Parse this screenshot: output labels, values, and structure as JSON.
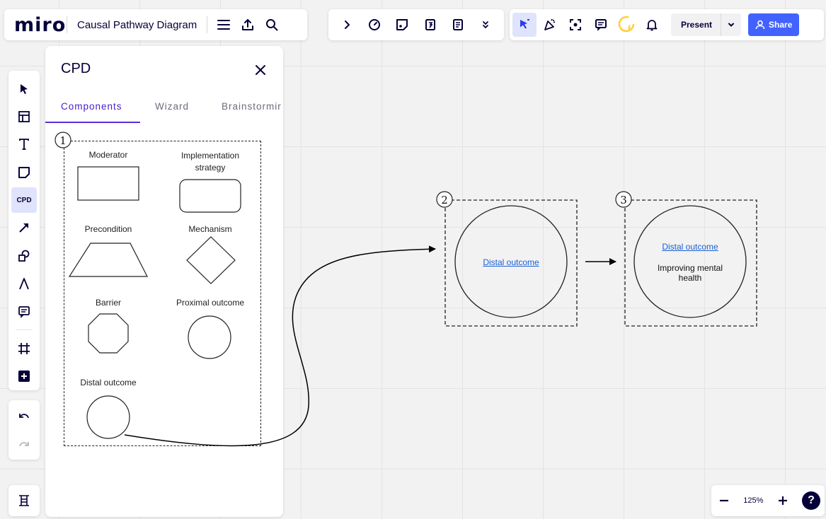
{
  "app": {
    "logo": "miro",
    "board_title": "Causal Pathway Diagram"
  },
  "collab": {
    "present_label": "Present",
    "share_label": "Share"
  },
  "left_toolbar": {
    "cpd_label": "CPD"
  },
  "panel": {
    "title": "CPD",
    "tabs": [
      {
        "label": "Components",
        "active": true
      },
      {
        "label": "Wizard",
        "active": false
      },
      {
        "label": "Brainstormir",
        "active": false
      }
    ],
    "components": {
      "frame_number": "1",
      "items": [
        {
          "label": "Moderator",
          "shape": "rectangle"
        },
        {
          "label": "Implementation strategy",
          "shape": "rounded-rectangle"
        },
        {
          "label": "Precondition",
          "shape": "trapezoid"
        },
        {
          "label": "Mechanism",
          "shape": "diamond"
        },
        {
          "label": "Barrier",
          "shape": "octagon"
        },
        {
          "label": "Proximal outcome",
          "shape": "circle"
        },
        {
          "label": "Distal outcome",
          "shape": "circle"
        }
      ]
    }
  },
  "canvas": {
    "frame2": {
      "number": "2",
      "link_text": "Distal outcome"
    },
    "frame3": {
      "number": "3",
      "link_text": "Distal outcome",
      "text": "Improving mental health"
    }
  },
  "zoom": {
    "level": "125%"
  },
  "help": {
    "label": "?"
  },
  "colors": {
    "accent": "#4262ff",
    "active_tab": "#4a1bcf",
    "link": "#1a5fd6",
    "active_tool_bg": "#dfe3fb"
  }
}
